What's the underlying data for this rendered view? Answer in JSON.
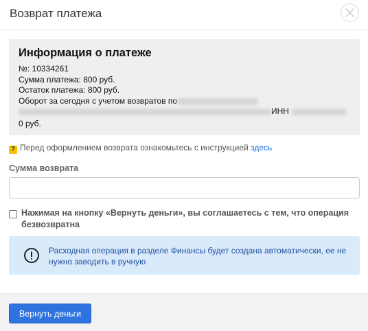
{
  "dialog": {
    "title": "Возврат платежа"
  },
  "info": {
    "title": "Информация о платеже",
    "number": "№: 10334261",
    "amount": "Сумма платежа: 800 руб.",
    "remainder": "Остаток платежа: 800 руб.",
    "turnover_prefix": "Оборот за сегодня с учетом возвратов по",
    "inn_label": "ИНН",
    "turnover_value": "0 руб."
  },
  "hint": {
    "text": "Перед оформлением возврата ознакомьтесь с инструкцией",
    "link": "здесь",
    "badge": "?"
  },
  "refund_amount": {
    "label": "Сумма возврата",
    "value": "",
    "placeholder": ""
  },
  "agreement": {
    "text": "Нажимая на кнопку «Вернуть деньги», вы соглашаетесь с тем, что операция безвозвратна",
    "checked": false
  },
  "notice": {
    "text": "Расходная операция в разделе Финансы будет создана автоматически, ее не нужно заводить в ручную",
    "icon": "exclamation-circle-icon"
  },
  "footer": {
    "refund_button": "Вернуть деньги"
  },
  "colors": {
    "primary": "#2f73e0",
    "notice_bg": "#d9eafb",
    "link": "#1f6fd6"
  }
}
